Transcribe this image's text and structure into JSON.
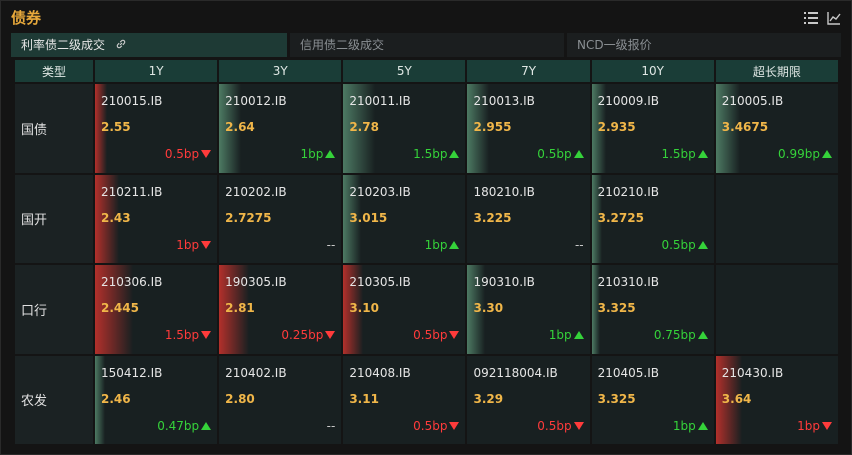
{
  "title": "债券",
  "tabs": [
    "利率债二级成交",
    "信用债二级成交",
    "NCD一级报价"
  ],
  "table": {
    "headers": [
      "类型",
      "1Y",
      "3Y",
      "5Y",
      "7Y",
      "10Y",
      "超长期限"
    ],
    "rows": [
      {
        "label": "国债",
        "cells": [
          {
            "code": "210015.IB",
            "yield": "2.55",
            "change": "0.5bp",
            "dir": "down"
          },
          {
            "code": "210012.IB",
            "yield": "2.64",
            "change": "1bp",
            "dir": "up"
          },
          {
            "code": "210011.IB",
            "yield": "2.78",
            "change": "1.5bp",
            "dir": "up"
          },
          {
            "code": "210013.IB",
            "yield": "2.955",
            "change": "0.5bp",
            "dir": "up"
          },
          {
            "code": "210009.IB",
            "yield": "2.935",
            "change": "1.5bp",
            "dir": "up"
          },
          {
            "code": "210005.IB",
            "yield": "3.4675",
            "change": "0.99bp",
            "dir": "up"
          }
        ]
      },
      {
        "label": "国开",
        "cells": [
          {
            "code": "210211.IB",
            "yield": "2.43",
            "change": "1bp",
            "dir": "down"
          },
          {
            "code": "210202.IB",
            "yield": "2.7275",
            "change": "--",
            "dir": "flat"
          },
          {
            "code": "210203.IB",
            "yield": "3.015",
            "change": "1bp",
            "dir": "up"
          },
          {
            "code": "180210.IB",
            "yield": "3.225",
            "change": "--",
            "dir": "flat"
          },
          {
            "code": "210210.IB",
            "yield": "3.2725",
            "change": "0.5bp",
            "dir": "up"
          },
          null
        ]
      },
      {
        "label": "口行",
        "cells": [
          {
            "code": "210306.IB",
            "yield": "2.445",
            "change": "1.5bp",
            "dir": "down"
          },
          {
            "code": "190305.IB",
            "yield": "2.81",
            "change": "0.25bp",
            "dir": "down"
          },
          {
            "code": "210305.IB",
            "yield": "3.10",
            "change": "0.5bp",
            "dir": "down"
          },
          {
            "code": "190310.IB",
            "yield": "3.30",
            "change": "1bp",
            "dir": "up"
          },
          {
            "code": "210310.IB",
            "yield": "3.325",
            "change": "0.75bp",
            "dir": "up"
          },
          null
        ]
      },
      {
        "label": "农发",
        "cells": [
          {
            "code": "150412.IB",
            "yield": "2.46",
            "change": "0.47bp",
            "dir": "up"
          },
          {
            "code": "210402.IB",
            "yield": "2.80",
            "change": "--",
            "dir": "flat"
          },
          {
            "code": "210408.IB",
            "yield": "3.11",
            "change": "0.5bp",
            "dir": "down"
          },
          {
            "code": "092118004.IB",
            "yield": "3.29",
            "change": "0.5bp",
            "dir": "down"
          },
          {
            "code": "210405.IB",
            "yield": "3.325",
            "change": "1bp",
            "dir": "up"
          },
          {
            "code": "210430.IB",
            "yield": "3.64",
            "change": "1bp",
            "dir": "down"
          }
        ]
      }
    ]
  },
  "colors": {
    "up": "#35d23a",
    "down": "#ff3b3b",
    "yield": "#f0b649",
    "title": "#e8a93b"
  }
}
